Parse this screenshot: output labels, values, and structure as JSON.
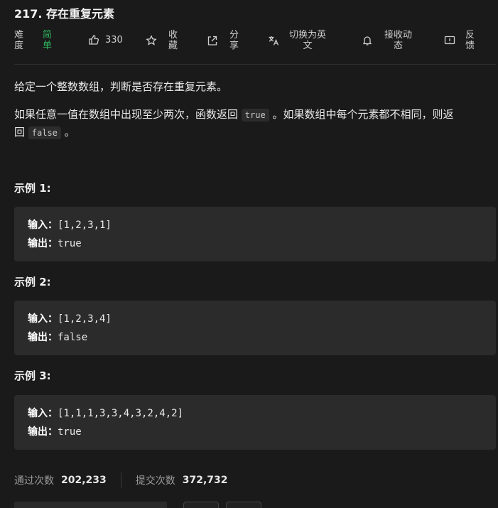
{
  "problem": {
    "title": "217. 存在重复元素"
  },
  "toolbar": {
    "difficulty_label": [
      "难",
      "度"
    ],
    "difficulty_value": [
      "简",
      "单"
    ],
    "likes": "330",
    "favorite": [
      "收",
      "藏"
    ],
    "share": [
      "分",
      "享"
    ],
    "switch_en": [
      "切换为英",
      "文"
    ],
    "subscribe": [
      "接收动",
      "态"
    ],
    "feedback": [
      "反",
      "馈"
    ]
  },
  "description": {
    "p1": "给定一个整数数组，判断是否存在重复元素。",
    "p2_a": "如果任意一值在数组中出现至少两次，函数返回 ",
    "p2_code1": "true",
    "p2_b": " 。如果数组中每个元素都不相同，则返",
    "p2_c": "回 ",
    "p2_code2": "false",
    "p2_d": " 。"
  },
  "examples": [
    {
      "title": "示例 1:",
      "input_label": "输入：",
      "input": "[1,2,3,1]",
      "output_label": "输出：",
      "output": "true"
    },
    {
      "title": "示例 2:",
      "input_label": "输入：",
      "input": "[1,2,3,4]",
      "output_label": "输出：",
      "output": "false"
    },
    {
      "title": "示例 3:",
      "input_label": "输入：",
      "input": "[1,1,1,3,3,4,3,2,4,2]",
      "output_label": "输出：",
      "output": "true"
    }
  ],
  "stats": {
    "accepted_label": "通过次数",
    "accepted_value": "202,233",
    "submissions_label": "提交次数",
    "submissions_value": "372,732"
  },
  "colors": {
    "background": "#1a1a1a",
    "easy": "#2db55d",
    "code_bg": "#2b2b2b"
  }
}
